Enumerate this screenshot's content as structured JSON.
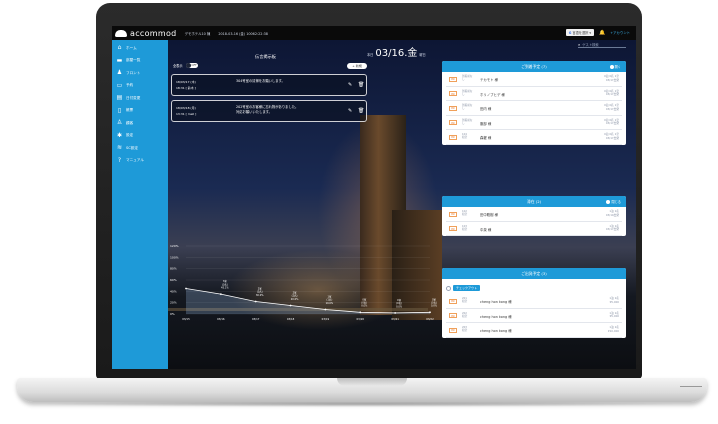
{
  "app": {
    "name": "accommod",
    "hotel": "デモホテル10 棟",
    "datetime": "2018-03-16 (金) 10062:22:38",
    "language": "言語を選択",
    "account": "+アカウント",
    "search_placeholder": "ゲスト検索"
  },
  "sidebar": {
    "items": [
      {
        "label": "ホーム",
        "icon": "home-icon",
        "glyph": "⌂"
      },
      {
        "label": "部屋一覧",
        "icon": "bed-icon",
        "glyph": "▬"
      },
      {
        "label": "フロント",
        "icon": "front-desk-icon",
        "glyph": "♟"
      },
      {
        "label": "予約",
        "icon": "reservation-icon",
        "glyph": "▭"
      },
      {
        "label": "日付変更",
        "icon": "calendar-icon",
        "glyph": "▤"
      },
      {
        "label": "帳票",
        "icon": "document-icon",
        "glyph": "▯"
      },
      {
        "label": "顧客",
        "icon": "person-icon",
        "glyph": "♙"
      },
      {
        "label": "設定",
        "icon": "gear-icon",
        "glyph": "✱"
      },
      {
        "label": "SC設定",
        "icon": "wifi-icon",
        "glyph": "≋"
      },
      {
        "label": "マニュアル",
        "icon": "help-icon",
        "glyph": "?"
      }
    ]
  },
  "notice": {
    "title": "伝言掲示板",
    "show_all_label": "全表示",
    "toggle_state": "OFF",
    "new_label": "新規",
    "items": [
      {
        "date": "18/03/17 (木)",
        "time": "18:31 [ 鈴木 ]",
        "text": "304号室の清掃をお願いします。"
      },
      {
        "date": "18/03/18 (月)",
        "time": "13:31 [ mell ]",
        "line1": "202号室のお客様に忘れ物がありました。",
        "line2": "対応お願いいたします。"
      }
    ]
  },
  "date": {
    "prefix": "本日",
    "main": "03/16.金",
    "suffix": "曜日"
  },
  "chart_data": {
    "type": "line",
    "yticks": [
      "120%",
      "100%",
      "80%",
      "60%",
      "40%",
      "20%",
      "0%"
    ],
    "ylim": [
      0,
      120
    ],
    "categories": [
      "03/15",
      "03/16",
      "03/17",
      "03/18",
      "03/19",
      "03/20",
      "03/21",
      "03/22"
    ],
    "values": [
      45,
      35,
      22,
      15,
      8,
      3,
      2,
      3
    ],
    "labels": [
      [
        "",
        "",
        "",
        ""
      ],
      [
        "3室",
        "(3名)",
        "45.1%",
        ""
      ],
      [
        "2室",
        "(2名)",
        "30.0%",
        ""
      ],
      [
        "2室",
        "(2名)",
        "20.0%",
        ""
      ],
      [
        "1室",
        "(1名)",
        "10.0%",
        ""
      ],
      [
        "0室",
        "(0名)",
        "0.0%",
        ""
      ],
      [
        "0室",
        "(0名)",
        "0.0%",
        ""
      ],
      [
        "0室",
        "(0名)",
        "0.0%",
        ""
      ]
    ],
    "colors": {
      "line": "#ffffff",
      "fill": "#9fc4f0"
    }
  },
  "arrivals": {
    "title": "ご到着予定 (7)",
    "button": "開く",
    "rows": [
      {
        "ck": "IN",
        "meta1": "到着前な",
        "meta2": "し",
        "name": "テカモト 様",
        "rt1": "0泊 0名 1室",
        "rt2": "03/17出発"
      },
      {
        "ck": "IN",
        "meta1": "到着前な",
        "meta2": "し",
        "name": "ホリノブヒデ 様",
        "rt1": "0泊 0名 1室",
        "rt2": "03/17出発"
      },
      {
        "ck": "IN",
        "meta1": "到着前な",
        "meta2": "し",
        "name": "田内 様",
        "rt1": "0泊 0名 1室",
        "rt2": "03/17出発"
      },
      {
        "ck": "IN",
        "meta1": "到着前な",
        "meta2": "し",
        "name": "服部 様",
        "rt1": "0泊 0名 1室",
        "rt2": "03/17出発"
      },
      {
        "ck": "IN",
        "meta1": "104",
        "meta2": "和室",
        "name": "森櫂 様",
        "rt1": "0泊 0名 1室",
        "rt2": "03/17出発"
      }
    ]
  },
  "staying": {
    "title": "滞在 (2)",
    "button": "閉じる",
    "rows": [
      {
        "ck": "IN",
        "meta1": "102",
        "meta2": "和室",
        "name": "田中聡樹 様",
        "rt1": "1泊 1名",
        "rt2": "03/19出発"
      },
      {
        "ck": "IN",
        "meta1": "103",
        "meta2": "和室",
        "name": "中泉 様",
        "rt1": "1泊 1名",
        "rt2": "03/17出発"
      }
    ]
  },
  "departures": {
    "title": "ご出発予定 (3)",
    "checkout_label": "チェックアウト",
    "rows": [
      {
        "ck": "IN",
        "meta1": "201",
        "meta2": "和室",
        "name": "cheng hon kong 様",
        "rt1": "1泊 1名",
        "rt2": "¥5,000"
      },
      {
        "ck": "IN",
        "meta1": "202",
        "meta2": "和室",
        "name": "cheng hon kong 様",
        "rt1": "1泊 1名",
        "rt2": "¥5,000"
      },
      {
        "ck": "IN",
        "meta1": "203",
        "meta2": "和室",
        "name": "cheng hon kong 様",
        "rt1": "1泊 1名",
        "rt2": "¥10,000"
      }
    ]
  }
}
